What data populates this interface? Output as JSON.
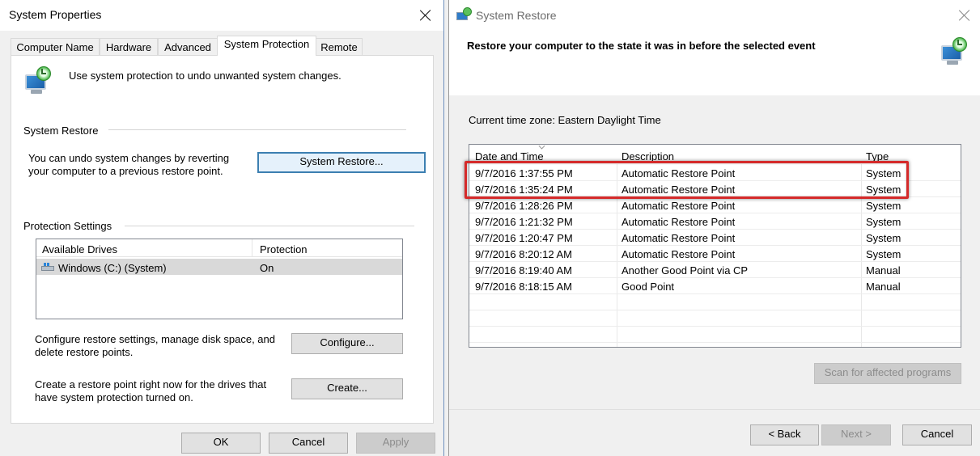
{
  "system_properties": {
    "title": "System Properties",
    "tabs": [
      {
        "label": "Computer Name"
      },
      {
        "label": "Hardware"
      },
      {
        "label": "Advanced"
      },
      {
        "label": "System Protection",
        "active": true
      },
      {
        "label": "Remote"
      }
    ],
    "intro_text": "Use system protection to undo unwanted system changes.",
    "system_restore_group": {
      "heading": "System Restore",
      "description_line1": "You can undo system changes by reverting",
      "description_line2": "your computer to a previous restore point.",
      "button_label": "System Restore..."
    },
    "protection_settings": {
      "heading": "Protection Settings",
      "columns": [
        "Available Drives",
        "Protection"
      ],
      "drives": [
        {
          "name": "Windows (C:) (System)",
          "protection": "On"
        }
      ],
      "configure_text_line1": "Configure restore settings, manage disk space, and",
      "configure_text_line2": "delete restore points.",
      "configure_button": "Configure...",
      "create_text_line1": "Create a restore point right now for the drives that",
      "create_text_line2": "have system protection turned on.",
      "create_button": "Create..."
    },
    "buttons": {
      "ok": "OK",
      "cancel": "Cancel",
      "apply": "Apply"
    }
  },
  "system_restore": {
    "title": "System Restore",
    "headline": "Restore your computer to the state it was in before the selected event",
    "timezone": "Current time zone: Eastern Daylight Time",
    "columns": [
      "Date and Time",
      "Description",
      "Type"
    ],
    "restore_points": [
      {
        "date": "9/7/2016 1:37:55 PM",
        "description": "Automatic Restore Point",
        "type": "System"
      },
      {
        "date": "9/7/2016 1:35:24 PM",
        "description": "Automatic Restore Point",
        "type": "System"
      },
      {
        "date": "9/7/2016 1:28:26 PM",
        "description": "Automatic Restore Point",
        "type": "System"
      },
      {
        "date": "9/7/2016 1:21:32 PM",
        "description": "Automatic Restore Point",
        "type": "System"
      },
      {
        "date": "9/7/2016 1:20:47 PM",
        "description": "Automatic Restore Point",
        "type": "System"
      },
      {
        "date": "9/7/2016 8:20:12 AM",
        "description": "Automatic Restore Point",
        "type": "System"
      },
      {
        "date": "9/7/2016 8:19:40 AM",
        "description": "Another Good Point via CP",
        "type": "Manual"
      },
      {
        "date": "9/7/2016 8:18:15 AM",
        "description": "Good Point",
        "type": "Manual"
      }
    ],
    "scan_button": "Scan for affected programs",
    "buttons": {
      "back": "< Back",
      "next": "Next >",
      "cancel": "Cancel"
    }
  },
  "colors": {
    "highlight_border": "#d52a2a",
    "focus_border": "#3c7fb1"
  }
}
